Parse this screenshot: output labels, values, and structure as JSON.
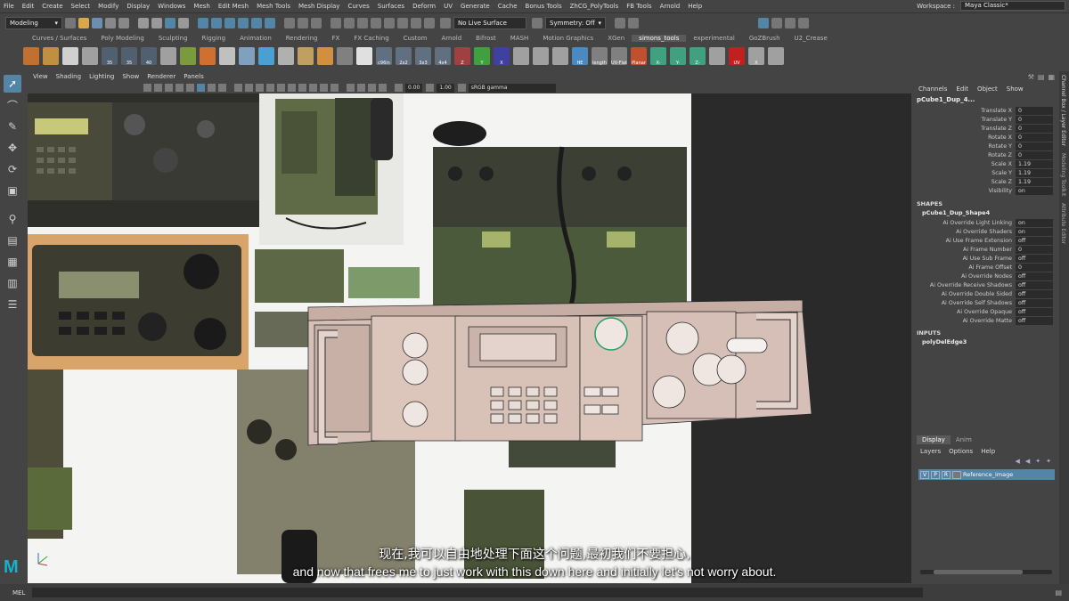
{
  "menubar": {
    "items": [
      "File",
      "Edit",
      "Create",
      "Select",
      "Modify",
      "Display",
      "Windows",
      "Mesh",
      "Edit Mesh",
      "Mesh Tools",
      "Mesh Display",
      "Curves",
      "Surfaces",
      "Deform",
      "UV",
      "Generate",
      "Cache",
      "Bonus Tools",
      "ZhCG_PolyTools",
      "FB Tools",
      "Arnold",
      "Help"
    ],
    "workspace_label": "Workspace :",
    "workspace_value": "Maya Classic*"
  },
  "statusline": {
    "mode": "Modeling",
    "live_surface": "No Live Surface",
    "symmetry": "Symmetry: Off"
  },
  "shelf_tabs": {
    "items": [
      "Curves / Surfaces",
      "Poly Modeling",
      "Sculpting",
      "Rigging",
      "Animation",
      "Rendering",
      "FX",
      "FX Caching",
      "Custom",
      "Arnold",
      "Bifrost",
      "MASH",
      "Motion Graphics",
      "XGen",
      "simons_tools",
      "experimental",
      "GoZBrush",
      "U2_Crease"
    ],
    "active": "simons_tools"
  },
  "shelf_icons": [
    {
      "label": "",
      "color": "#c07030"
    },
    {
      "label": "",
      "color": "#c09040"
    },
    {
      "label": "",
      "color": "#d0d0d0"
    },
    {
      "label": "",
      "color": "#a0a0a0"
    },
    {
      "label": "35",
      "color": "#506070"
    },
    {
      "label": "35",
      "color": "#506070"
    },
    {
      "label": "40",
      "color": "#506070"
    },
    {
      "label": "",
      "color": "#a0a0a0"
    },
    {
      "label": "",
      "color": "#7a9a40"
    },
    {
      "label": "",
      "color": "#d07030"
    },
    {
      "label": "",
      "color": "#c0c0c0"
    },
    {
      "label": "",
      "color": "#80a0c0"
    },
    {
      "label": "",
      "color": "#4aa0d0"
    },
    {
      "label": "",
      "color": "#b0b0b0"
    },
    {
      "label": "",
      "color": "#c0a060"
    },
    {
      "label": "",
      "color": "#d09040"
    },
    {
      "label": "",
      "color": "#808080"
    },
    {
      "label": "",
      "color": "#e0e0e0"
    },
    {
      "label": "c96in",
      "color": "#607080"
    },
    {
      "label": "2x2",
      "color": "#607080"
    },
    {
      "label": "3x3",
      "color": "#607080"
    },
    {
      "label": "4x4",
      "color": "#607080"
    },
    {
      "label": "Z",
      "color": "#a04040"
    },
    {
      "label": "Y",
      "color": "#40a040"
    },
    {
      "label": "X",
      "color": "#4040a0"
    },
    {
      "label": "",
      "color": "#a0a0a0"
    },
    {
      "label": "",
      "color": "#a0a0a0"
    },
    {
      "label": "",
      "color": "#a0a0a0"
    },
    {
      "label": "HE",
      "color": "#4a8ac0"
    },
    {
      "label": "length",
      "color": "#808080"
    },
    {
      "label": "UV-Flat",
      "color": "#808080"
    },
    {
      "label": "Planar",
      "color": "#c05030"
    },
    {
      "label": "X-",
      "color": "#40a080"
    },
    {
      "label": "Y-",
      "color": "#40a080"
    },
    {
      "label": "Z-",
      "color": "#40a080"
    },
    {
      "label": "",
      "color": "#a0a0a0"
    },
    {
      "label": "UV",
      "color": "#c02020"
    },
    {
      "label": "X",
      "color": "#a0a0a0"
    },
    {
      "label": "",
      "color": "#a0a0a0"
    }
  ],
  "panel_menu": [
    "View",
    "Shading",
    "Lighting",
    "Show",
    "Renderer",
    "Panels"
  ],
  "panel_bar": {
    "value1": "0.00",
    "value2": "1.00",
    "colorspace": "sRGB gamma"
  },
  "channelbox": {
    "menu": [
      "Channels",
      "Edit",
      "Object",
      "Show"
    ],
    "object_name": "pCube1_Dup_4...",
    "transforms": [
      {
        "name": "Translate X",
        "value": "0"
      },
      {
        "name": "Translate Y",
        "value": "0"
      },
      {
        "name": "Translate Z",
        "value": "0"
      },
      {
        "name": "Rotate X",
        "value": "0"
      },
      {
        "name": "Rotate Y",
        "value": "0"
      },
      {
        "name": "Rotate Z",
        "value": "0"
      },
      {
        "name": "Scale X",
        "value": "1.19"
      },
      {
        "name": "Scale Y",
        "value": "1.19"
      },
      {
        "name": "Scale Z",
        "value": "1.19"
      },
      {
        "name": "Visibility",
        "value": "on"
      }
    ],
    "shapes_header": "SHAPES",
    "shape_name": "pCube1_Dup_Shape4",
    "shape_attrs": [
      {
        "name": "Ai Override Light Linking",
        "value": "on"
      },
      {
        "name": "Ai Override Shaders",
        "value": "on"
      },
      {
        "name": "Ai Use Frame Extension",
        "value": "off"
      },
      {
        "name": "Ai Frame Number",
        "value": "0"
      },
      {
        "name": "Ai Use Sub Frame",
        "value": "off"
      },
      {
        "name": "Ai Frame Offset",
        "value": "0"
      },
      {
        "name": "Ai Override Nodes",
        "value": "off"
      },
      {
        "name": "Ai Override Receive Shadows",
        "value": "off"
      },
      {
        "name": "Ai Override Double Sided",
        "value": "off"
      },
      {
        "name": "Ai Override Self Shadows",
        "value": "off"
      },
      {
        "name": "Ai Override Opaque",
        "value": "off"
      },
      {
        "name": "Ai Override Matte",
        "value": "off"
      }
    ],
    "inputs_header": "INPUTS",
    "input_name": "polyDelEdge3"
  },
  "side_tabs": [
    "Channel Box / Layer Editor",
    "Modeling Toolkit",
    "Attribute Editor"
  ],
  "layers": {
    "tabs": [
      "Display",
      "Anim"
    ],
    "menu": [
      "Layers",
      "Options",
      "Help"
    ],
    "layer": {
      "v": "V",
      "p": "P",
      "r": "R",
      "name": "Reference_image"
    }
  },
  "cmdline": {
    "label": "MEL"
  },
  "subtitles": {
    "cn": "现在,我可以自由地处理下面这个问题,最初我们不要担心,",
    "en": "and now that frees me to just work with this down here and initially let's not worry about."
  },
  "logo": {
    "text": "M",
    "color": "#19b0c9"
  },
  "colors": {
    "accent": "#5285a6",
    "ui_bg": "#444444",
    "field_bg": "#2b2b2b",
    "highlight": "#24a06b"
  }
}
